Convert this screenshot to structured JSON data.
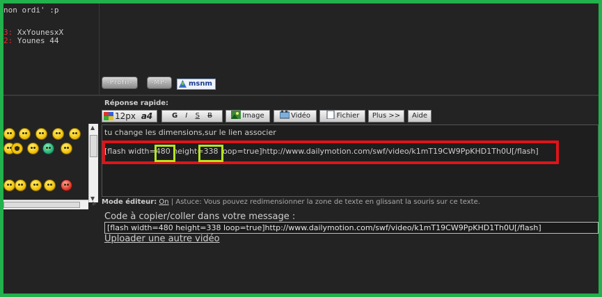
{
  "top": {
    "status_text": "non ordi' :p",
    "users": [
      {
        "num": "3:",
        "name": "XxYounesxX"
      },
      {
        "num": "2:",
        "name": "Younes 44"
      }
    ]
  },
  "profile_buttons": {
    "profil": "-Profil-",
    "mp": "-MP-",
    "msnm": "msnm"
  },
  "quick_reply": {
    "label": "Réponse rapide:",
    "toolbar": {
      "font_size": "12px",
      "font_glyph": "a4",
      "bold": "G",
      "italic": "I",
      "strike": "S",
      "strike2": "B",
      "image": "Image",
      "video": "Vidéo",
      "file": "Fichier",
      "more": "Plus >>",
      "help": "Aide"
    },
    "editor": {
      "line1": "tu change les dimensions,sur le lien associer",
      "line2": "[flash width=480 height=338 loop=true]http://www.dailymotion.com/swf/video/k1mT19CW9PpKHD1Th0U[/flash]"
    }
  },
  "mode": {
    "label": "Mode éditeur:",
    "on_link": "On",
    "tip": "| Astuce: Vous pouvez redimensionner la zone de texte en glissant la souris sur ce texte."
  },
  "video": {
    "copy_label": "Code à copier/coller dans votre message :",
    "code": "[flash width=480 height=338 loop=true]http://www.dailymotion.com/swf/video/k1mT19CW9PpKHD1Th0U[/flash]",
    "upload_link": "Uploader une autre vidéo"
  },
  "colors": {
    "frame": "#22b14c",
    "highlight_red": "#e0131a",
    "highlight_green": "#b5e61d"
  }
}
